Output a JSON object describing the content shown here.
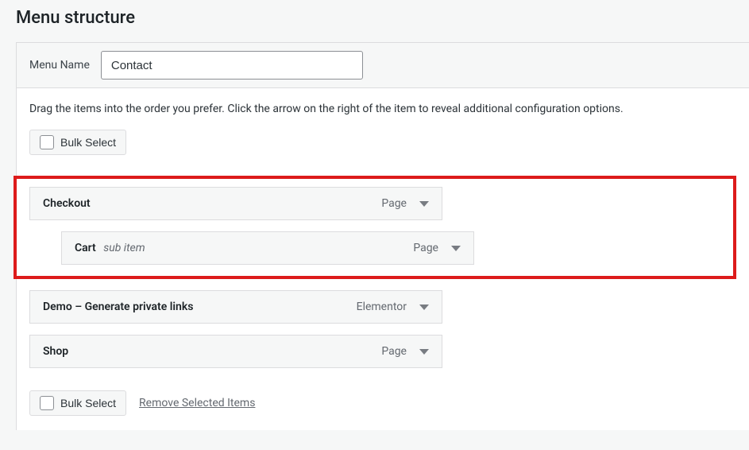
{
  "header": {
    "title": "Menu structure"
  },
  "menu_name": {
    "label": "Menu Name",
    "value": "Contact"
  },
  "help_text": "Drag the items into the order you prefer. Click the arrow on the right of the item to reveal additional configuration options.",
  "bulk_select_label": "Bulk Select",
  "remove_selected_label": "Remove Selected Items",
  "menu_items": [
    {
      "title": "Checkout",
      "type": "Page",
      "sub": false
    },
    {
      "title": "Cart",
      "type": "Page",
      "sub": true,
      "sub_label": "sub item"
    },
    {
      "title": "Demo – Generate private links",
      "type": "Elementor",
      "sub": false
    },
    {
      "title": "Shop",
      "type": "Page",
      "sub": false
    }
  ]
}
